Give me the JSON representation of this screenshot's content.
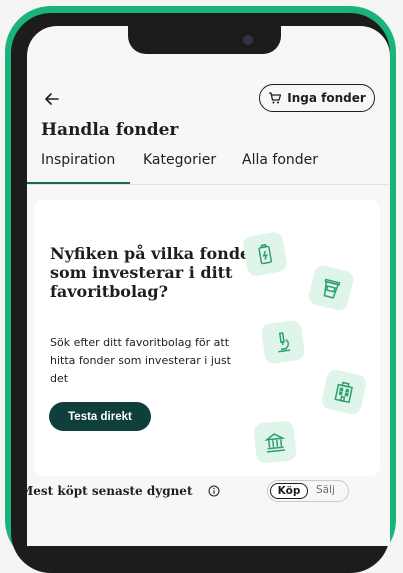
{
  "header": {
    "cart_label": "Inga fonder",
    "title": "Handla fonder"
  },
  "tabs": [
    {
      "label": "Inspiration",
      "active": true
    },
    {
      "label": "Kategorier",
      "active": false
    },
    {
      "label": "Alla fonder",
      "active": false
    }
  ],
  "promo": {
    "heading": "Nyfiken på vilka fonder som investerar i ditt favoritbolag?",
    "body": "Sök efter ditt favoritbolag för att hitta fonder som investerar i just det",
    "button_label": "Testa direkt",
    "icons": [
      "battery-icon",
      "coffee-cup-icon",
      "microscope-icon",
      "building-icon",
      "bank-icon"
    ]
  },
  "section": {
    "title": "Mest köpt senaste dygnet",
    "toggle": {
      "buy_label": "Köp",
      "sell_label": "Sälj",
      "selected": "Köp"
    }
  },
  "colors": {
    "brand_green": "#18b47a",
    "accent_dark": "#0f3f3b",
    "tile_bg": "#dff5ea",
    "icon_green": "#2f9e6f"
  }
}
